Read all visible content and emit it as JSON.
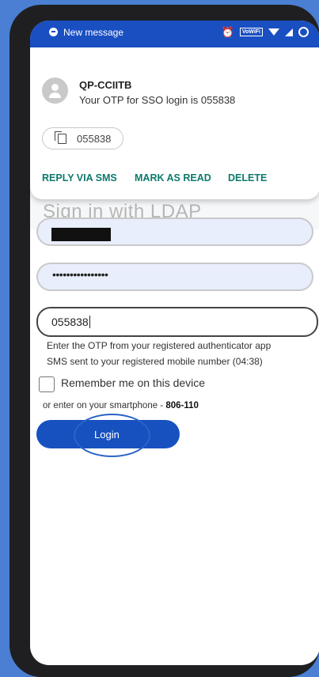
{
  "status_bar": {
    "notification_text": "New message",
    "wifi_label": "VoWiFi",
    "icons": [
      "message-icon",
      "alarm-icon",
      "wifi-icon",
      "signal-icon",
      "battery-icon"
    ]
  },
  "notification": {
    "sender": "QP-CCIITB",
    "body": "Your OTP for SSO login is 055838",
    "copy_chip_text": "055838",
    "actions": [
      "REPLY VIA SMS",
      "MARK AS READ",
      "DELETE"
    ],
    "action_color": "#0e7a6b"
  },
  "page": {
    "title": "Sign in with LDAP",
    "password_mask": "••••••••••••••••",
    "otp_value": "055838",
    "otp_hint": "Enter the OTP from your registered authenticator app",
    "sms_hint": "SMS sent to your registered mobile number (04:38)",
    "remember_label": "Remember me on this device",
    "remember_checked": false,
    "alt_prefix": "or enter on your smartphone - ",
    "alt_code": "806-110",
    "login_label": "Login"
  },
  "colors": {
    "background": "#4a7fd4",
    "status_bar": "#1a4fc2",
    "login_button": "#1751c0",
    "field_fill": "#e8eefb"
  }
}
